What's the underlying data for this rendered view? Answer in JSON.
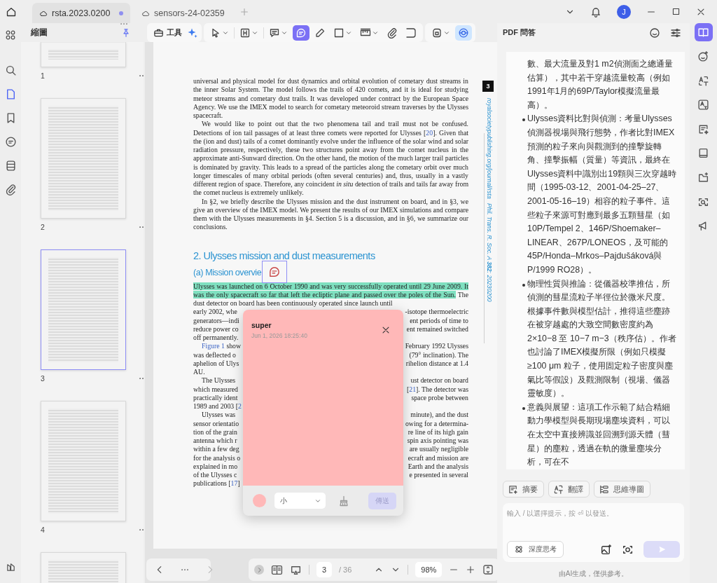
{
  "tabs": [
    {
      "label": "rsta.2023.0200",
      "selected": true,
      "unsaved": true
    },
    {
      "label": "sensors-24-02359",
      "selected": false,
      "unsaved": false
    }
  ],
  "user": {
    "initial": "J"
  },
  "left_rail": [
    {
      "selected": false
    },
    {
      "selected": true
    },
    {
      "selected": false
    },
    {
      "selected": false
    },
    {
      "selected": false
    },
    {
      "selected": false
    }
  ],
  "sidebar": {
    "title": "縮圖",
    "thumbnails": [
      {
        "page": "1",
        "selected": false
      },
      {
        "page": "2",
        "selected": false
      },
      {
        "page": "3",
        "selected": true
      },
      {
        "page": "4",
        "selected": false
      }
    ]
  },
  "toolbar": {
    "tools_label": "工具",
    "tools": [
      {
        "selected": false
      },
      {
        "selected": false
      },
      {
        "selected": false
      },
      {
        "selected": true
      },
      {
        "selected": false
      },
      {
        "selected": false
      },
      {
        "selected": false
      },
      {
        "selected": false
      },
      {
        "selected": false
      },
      {
        "selected": false
      },
      {
        "selected": true
      }
    ]
  },
  "document": {
    "page_badge": "3",
    "margin_url": "royalsocietypublishing.org/journal/rsta",
    "margin_citation": "Phil. Trans. R. Soc. A **382**: 20230200",
    "blocks": [
      {
        "kind": "paragraph",
        "indent": false,
        "segments": [
          {
            "kind": "plain",
            "text": "universal and physical model for dust dynamics and orbital evolution of cometary dust streams in the inner Solar System. The model follows the trails of 420 comets, and it is ideal for studying meteor streams and cometary dust trails. It was developed under contract by the European Space Agency. We use the IMEX model to search for cometary meteoroid stream traverses by the Ulysses spacecraft."
          }
        ]
      },
      {
        "kind": "paragraph",
        "indent": true,
        "segments": [
          {
            "kind": "plain",
            "text": "We would like to point out that the two phenomena tail and trail must not be confused. Detections of ion tail passages of at least three comets were reported for Ulysses ["
          },
          {
            "kind": "link",
            "text": "20"
          },
          {
            "kind": "plain",
            "text": "]. Given that the (ion and dust) tails of a comet dominantly evolve under the influence of the solar wind and solar radiation pressure, respectively, these two structures point away from the comet nucleus in the approximate anti-Sunward direction. On the other hand, the motion of the much larger trail particles is dominated by gravity. This leads to a spread of the particles along the cometary orbit over much longer timescales of many orbital periods (often several centuries) and, thus, usually in a vastly different region of space. Therefore, any coincident "
          },
          {
            "kind": "italic",
            "text": "in situ"
          },
          {
            "kind": "plain",
            "text": " detection of trails and tails far away from the comet nucleus is extremely unlikely."
          }
        ]
      },
      {
        "kind": "paragraph",
        "indent": true,
        "segments": [
          {
            "kind": "plain",
            "text": "In §2, we briefly describe the Ulysses mission and the dust instrument on board, and in §3, we give an overview of the IMEX model. We present the results of our IMEX simulations and compare them with the Ulysses measurements in §4. Section 5 is a discussion, and in §6, we summarize our conclusions."
          }
        ]
      },
      {
        "kind": "heading",
        "text": "2. Ulysses mission and dust measurements"
      },
      {
        "kind": "subheading",
        "text": "(a) Mission overvie"
      },
      {
        "kind": "paragraph",
        "indent": false,
        "segments": [
          {
            "kind": "highlight",
            "text": "Ulysses was launched on 6 October 1990 and was very successfully operated until 29 June 2009. It was the only spacecraft so far that left the ecliptic plane and passed over the poles of the Sun."
          },
          {
            "kind": "plain",
            "text": " The dust detector on board has been continuously operated since launch until"
          }
        ]
      },
      {
        "kind": "split_line",
        "indent": false,
        "left": [
          {
            "kind": "plain",
            "text": "early 2002, whe"
          }
        ],
        "right": [
          {
            "kind": "plain",
            "text": "-isotope thermoelectric"
          }
        ]
      },
      {
        "kind": "split_line",
        "indent": false,
        "left": [
          {
            "kind": "plain",
            "text": "generators—indi"
          }
        ],
        "right": [
          {
            "kind": "plain",
            "text": "ent periods of time to"
          }
        ]
      },
      {
        "kind": "split_line",
        "indent": false,
        "left": [
          {
            "kind": "plain",
            "text": "reduce power co"
          }
        ],
        "right": [
          {
            "kind": "plain",
            "text": "ent remained switched"
          }
        ]
      },
      {
        "kind": "split_line",
        "indent": false,
        "left": [
          {
            "kind": "plain",
            "text": "off permanently."
          }
        ]
      },
      {
        "kind": "split_line",
        "indent": true,
        "left": [
          {
            "kind": "link",
            "text": "Figure 1"
          },
          {
            "kind": "plain",
            "text": " show"
          }
        ],
        "right": [
          {
            "kind": "plain",
            "text": "February 1992 Ulysses"
          }
        ]
      },
      {
        "kind": "split_line",
        "indent": false,
        "left": [
          {
            "kind": "plain",
            "text": "was deflected o"
          }
        ],
        "right": [
          {
            "kind": "plain",
            "text": "(79° inclination). The"
          }
        ]
      },
      {
        "kind": "split_line",
        "indent": false,
        "left": [
          {
            "kind": "plain",
            "text": "aphelion of Ulys"
          }
        ],
        "right": [
          {
            "kind": "plain",
            "text": "rihelion distance at 1.4"
          }
        ]
      },
      {
        "kind": "split_line",
        "indent": false,
        "left": [
          {
            "kind": "plain",
            "text": "AU."
          }
        ]
      },
      {
        "kind": "split_line",
        "indent": true,
        "left": [
          {
            "kind": "plain",
            "text": "The Ulysses"
          }
        ],
        "right": [
          {
            "kind": "plain",
            "text": "ust detector on board"
          }
        ]
      },
      {
        "kind": "split_line",
        "indent": false,
        "left": [
          {
            "kind": "plain",
            "text": "which measured"
          }
        ],
        "right": [
          {
            "kind": "plain",
            "text": "["
          },
          {
            "kind": "link",
            "text": "21"
          },
          {
            "kind": "plain",
            "text": "]. The detector was"
          }
        ]
      },
      {
        "kind": "split_line",
        "indent": false,
        "left": [
          {
            "kind": "plain",
            "text": "practically ident"
          }
        ],
        "right": [
          {
            "kind": "plain",
            "text": "space probe between"
          }
        ]
      },
      {
        "kind": "split_line",
        "indent": false,
        "left": [
          {
            "kind": "plain",
            "text": "1989 and 2003 ["
          },
          {
            "kind": "link",
            "text": "2"
          }
        ]
      },
      {
        "kind": "split_line",
        "indent": true,
        "left": [
          {
            "kind": "plain",
            "text": "Ulysses was"
          }
        ],
        "right": [
          {
            "kind": "plain",
            "text": "minute), and the dust"
          }
        ]
      },
      {
        "kind": "split_line",
        "indent": false,
        "left": [
          {
            "kind": "plain",
            "text": "sensor orientatio"
          }
        ],
        "right": [
          {
            "kind": "plain",
            "text": "owing for a determina-"
          }
        ]
      },
      {
        "kind": "split_line",
        "indent": false,
        "left": [
          {
            "kind": "plain",
            "text": "tion of the grain"
          }
        ],
        "right": [
          {
            "kind": "plain",
            "text": "re line of its high gain"
          }
        ]
      },
      {
        "kind": "split_line",
        "indent": false,
        "left": [
          {
            "kind": "plain",
            "text": "antenna which r"
          }
        ],
        "right": [
          {
            "kind": "plain",
            "text": "spin axis pointing was"
          }
        ]
      },
      {
        "kind": "split_line",
        "indent": false,
        "left": [
          {
            "kind": "plain",
            "text": "within a few deg"
          }
        ],
        "right": [
          {
            "kind": "plain",
            "text": "are usually negligible"
          }
        ]
      },
      {
        "kind": "split_line",
        "indent": false,
        "left": [
          {
            "kind": "plain",
            "text": "for the analysis o"
          }
        ],
        "right": [
          {
            "kind": "plain",
            "text": "ecraft and mission are"
          }
        ]
      },
      {
        "kind": "split_line",
        "indent": false,
        "left": [
          {
            "kind": "plain",
            "text": "explained in mo"
          }
        ],
        "right": [
          {
            "kind": "plain",
            "text": "Earth and the analysis"
          }
        ]
      },
      {
        "kind": "split_line",
        "indent": false,
        "left": [
          {
            "kind": "plain",
            "text": "of the Ulysses c"
          }
        ],
        "right": [
          {
            "kind": "plain",
            "text": "e presented in several"
          }
        ]
      },
      {
        "kind": "split_line",
        "indent": false,
        "left": [
          {
            "kind": "plain",
            "text": "publications ["
          },
          {
            "kind": "link",
            "text": "17"
          },
          {
            "kind": "plain",
            "text": "]"
          }
        ]
      }
    ]
  },
  "note_popup": {
    "title": "super",
    "timestamp": "Jun 1, 2026 18:25:40",
    "color": "#ffb8b8",
    "size": "小",
    "send": "傳送",
    "send_disabled": true
  },
  "bottom_bar": {
    "page": "3",
    "total": "/ 36",
    "zoom": "98%"
  },
  "ai_panel": {
    "title": "PDF 問答",
    "items": [
      {
        "kind": "continuation",
        "text": "數、最大流量及對1 m2偵測面之總通量估算），其中若干穿越流量較高（例如1991年1月的69P/Taylor模擬流量最高）。"
      },
      {
        "kind": "bullet",
        "text": "Ulysses資料比對與偵測：考量Ulysses偵測器視場與飛行態勢，作者比對IMEX預測的粒子來向與觀測到的撞擊旋轉角、撞擊振幅（質量）等資訊，最終在Ulysses資料中識別出19顆與三次穿越時間（1995-03-12、2001-04-25–27、2001-05-16–19）相容的粒子事件。這些粒子來源可對應到最多五顆彗星（如10P/Tempel 2、146P/Shoemaker–LINEAR、267P/LONEOS，及可能的45P/Honda–Mrkos–Pajdušáková與P/1999 RO28）。"
      },
      {
        "kind": "bullet",
        "text": "物理性質與推論：從儀器校準推估，所偵測的彗星流粒子半徑位於微米尺度。根據事件數與模型估計，推得這些塵跡在被穿越處的大致空間數密度約為2×10−8 至 10−7 m−3（秩序估）。作者也討論了IMEX模擬所限（例如只模擬≥100 μm 粒子，使用固定粒子密度與塵氣比等假設）及觀測限制（視場、儀器靈敏度）。"
      },
      {
        "kind": "bullet",
        "text": "意義與展望：這項工作示範了結合精細動力學模型與長期現場塵埃資料，可以在太空中直接辨識並回溯到源天體（彗星）的塵粒，透過在軌的微量塵埃分析，可在不"
      }
    ],
    "quick_actions": [
      "摘要",
      "翻譯",
      "思維導圖"
    ],
    "input_placeholder": "輸入 / 以選擇提示，按 ⏎ 以發送。",
    "deep_think": "深度思考",
    "send_disabled": true,
    "footer": "由AI生成，僅供參考。"
  },
  "right_rail": [
    {
      "selected": true
    },
    {
      "selected": false
    },
    {
      "selected": false
    },
    {
      "selected": false
    },
    {
      "selected": false
    },
    {
      "selected": false
    },
    {
      "selected": false
    },
    {
      "selected": false
    },
    {
      "selected": false
    }
  ]
}
